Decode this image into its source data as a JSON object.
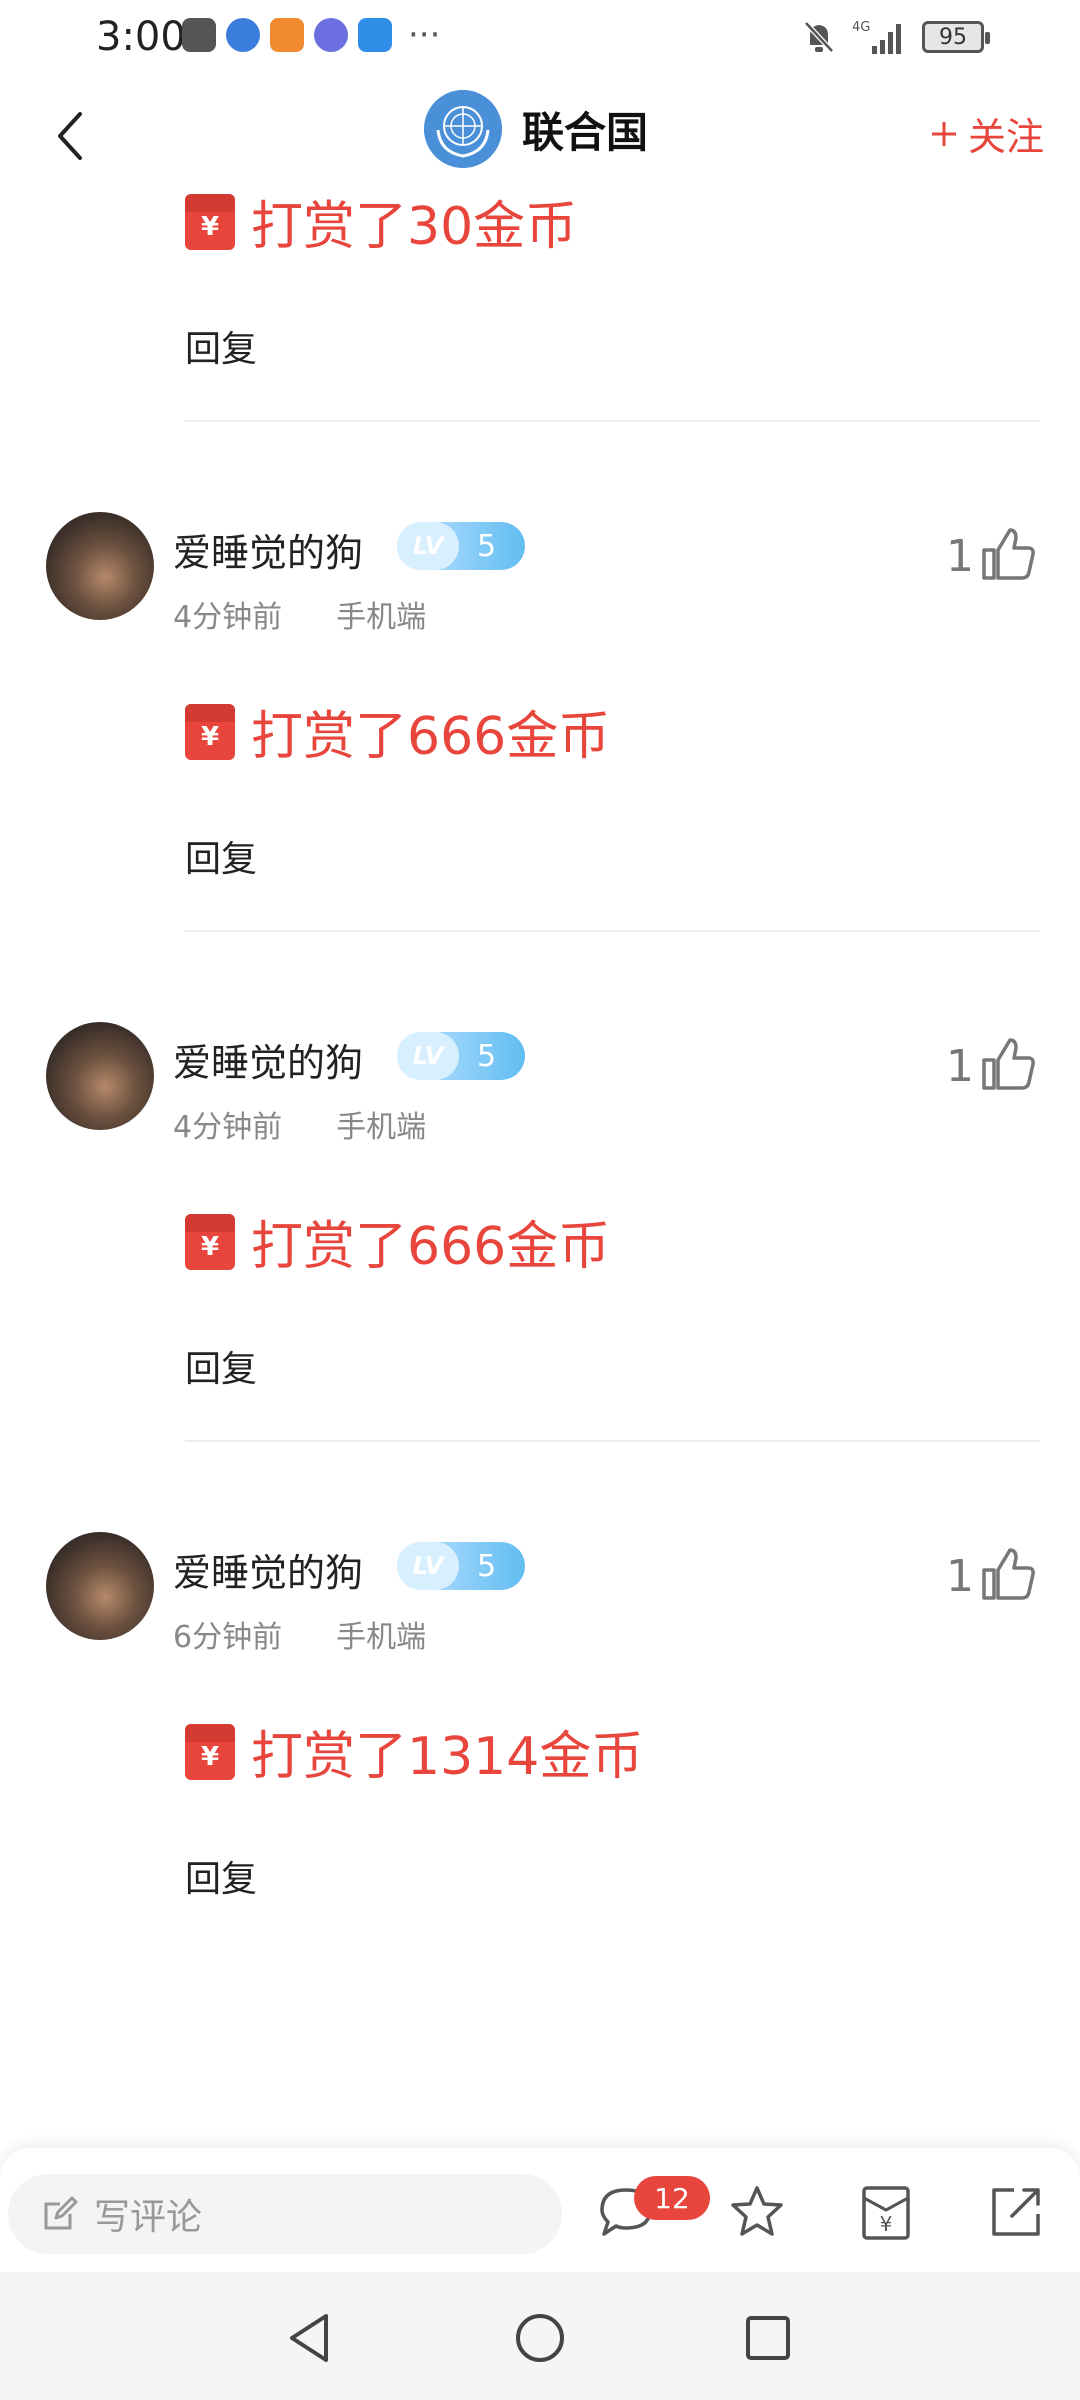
{
  "status_bar": {
    "time": "3:00",
    "more": "···",
    "battery": "95",
    "network": "4G",
    "app_colors": [
      "#555555",
      "#3b7ddd",
      "#f08b30",
      "#6b6fe0",
      "#2f8ee8"
    ]
  },
  "header": {
    "title": "联合国",
    "follow_label": "关注",
    "accent_color": "#e8453c"
  },
  "top_partial": {
    "reward_text": "打赏了30金币",
    "reply_label": "回复"
  },
  "comments": [
    {
      "username": "爱睡觉的狗",
      "level_tag": "LV",
      "level": "5",
      "time": "4分钟前",
      "device": "手机端",
      "likes": "1",
      "reward_text": "打赏了666金币",
      "reply_label": "回复"
    },
    {
      "username": "爱睡觉的狗",
      "level_tag": "LV",
      "level": "5",
      "time": "4分钟前",
      "device": "手机端",
      "likes": "1",
      "reward_text": "打赏了666金币",
      "reply_label": "回复"
    },
    {
      "username": "爱睡觉的狗",
      "level_tag": "LV",
      "level": "5",
      "time": "6分钟前",
      "device": "手机端",
      "likes": "1",
      "reward_text": "打赏了1314金币",
      "reply_label": "回复"
    }
  ],
  "redpacket_symbol": "¥",
  "comment_bar": {
    "placeholder": "写评论",
    "comment_count": "12",
    "icons": [
      "edit-icon",
      "comment-icon",
      "star-icon",
      "reward-icon",
      "share-icon"
    ]
  },
  "nav_bar": {
    "icons": [
      "back-triangle-icon",
      "home-circle-icon",
      "recents-square-icon"
    ]
  }
}
